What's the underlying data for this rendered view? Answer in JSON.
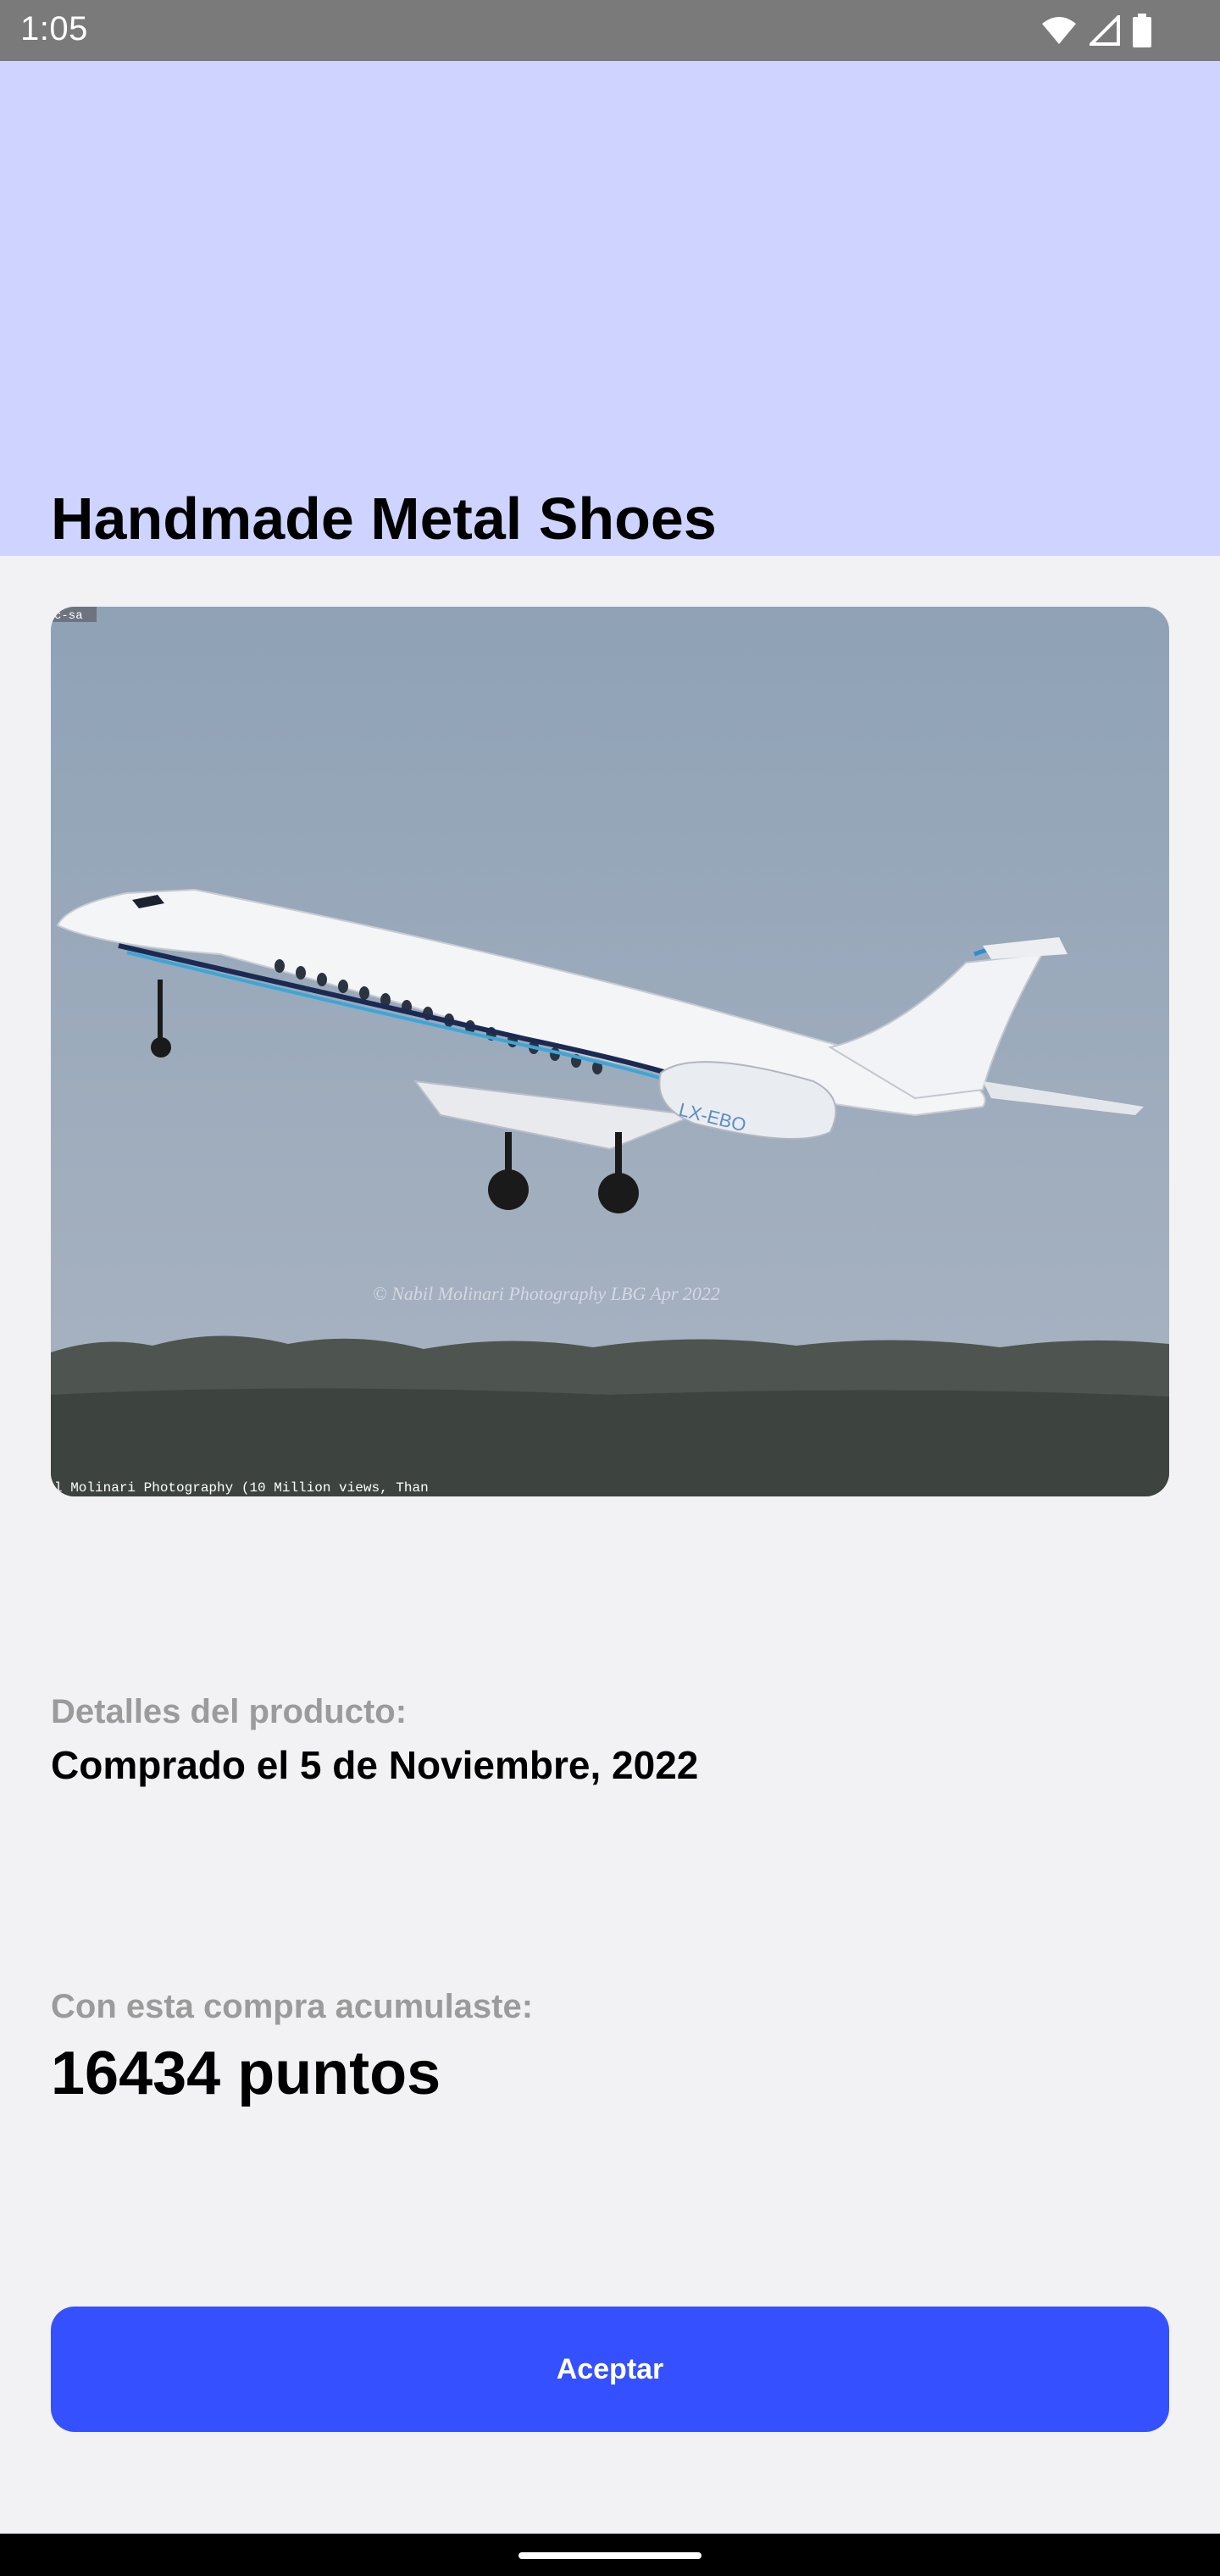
{
  "status_bar": {
    "time": "1:05",
    "icons": [
      "wifi-icon",
      "signal-icon",
      "battery-icon"
    ]
  },
  "header": {
    "title": "Handmade Metal Shoes",
    "background_color": "#ced4ff"
  },
  "product_image": {
    "description_icon": "airplane-photo",
    "registration": "LX-EBO",
    "watermark": "© Nabil Molinari Photography LBG Apr 2022",
    "caption": "l Molinari Photography (10 Million views, Than",
    "corner_tag": "c-sa"
  },
  "details": {
    "label": "Detalles del producto:",
    "value": "Comprado el 5 de Noviembre, 2022"
  },
  "points": {
    "label": "Con esta compra acumulaste:",
    "value": "16434 puntos"
  },
  "actions": {
    "accept_label": "Aceptar",
    "accept_color": "#3550ff"
  }
}
